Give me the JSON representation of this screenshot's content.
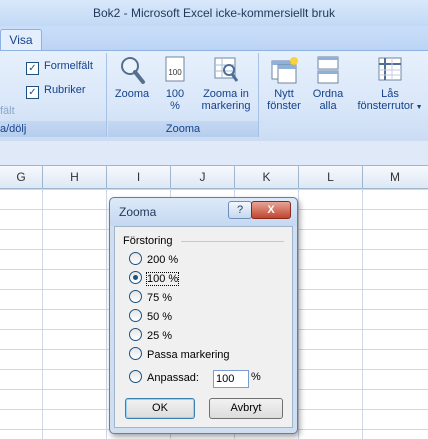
{
  "window": {
    "title": "Bok2 - Microsoft Excel icke-kommersiellt bruk"
  },
  "ribbon": {
    "active_tab": "Visa",
    "show_group": {
      "checkbox_formula_bar": "Formelfält",
      "checkbox_headings": "Rubriker",
      "partial_label": "fält",
      "group_label": "a/dölj"
    },
    "zoom_group": {
      "zoom_button": "Zooma",
      "hundred_button_line1": "100",
      "hundred_button_line2": "%",
      "zoom_selection_line1": "Zooma in",
      "zoom_selection_line2": "markering",
      "group_label": "Zooma"
    },
    "window_group": {
      "new_window_line1": "Nytt",
      "new_window_line2": "fönster",
      "arrange_line1": "Ordna",
      "arrange_line2": "alla",
      "freeze_line1": "Lås",
      "freeze_line2": "fönsterrutor"
    }
  },
  "columns": [
    "G",
    "H",
    "I",
    "J",
    "K",
    "L",
    "M"
  ],
  "dialog": {
    "title": "Zooma",
    "help_label": "?",
    "close_label": "X",
    "fieldset_legend": "Förstoring",
    "options": [
      {
        "label": "200 %",
        "selected": false
      },
      {
        "label": "100 %",
        "selected": true
      },
      {
        "label": "75 %",
        "selected": false
      },
      {
        "label": "50 %",
        "selected": false
      },
      {
        "label": "25 %",
        "selected": false
      },
      {
        "label": "Passa markering",
        "selected": false
      },
      {
        "label": "Anpassad:",
        "selected": false
      }
    ],
    "custom_value": "100",
    "custom_unit": "%",
    "ok_label": "OK",
    "cancel_label": "Avbryt"
  }
}
